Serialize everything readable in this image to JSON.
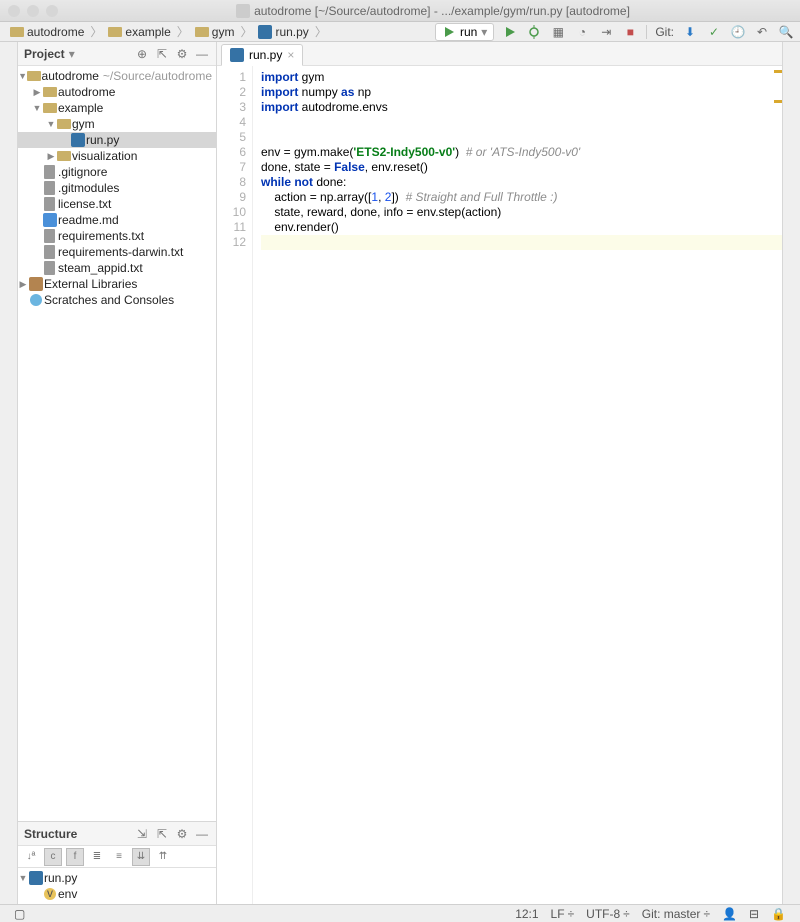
{
  "window_title": "autodrome [~/Source/autodrome] - .../example/gym/run.py [autodrome]",
  "breadcrumbs": [
    "autodrome",
    "example",
    "gym",
    "run.py"
  ],
  "run_config": "run",
  "git_label": "Git:",
  "project": {
    "title": "Project",
    "tree": [
      {
        "ind": 0,
        "arrow": "▼",
        "icon": "folder",
        "label": "autodrome",
        "muted": "~/Source/autodrome"
      },
      {
        "ind": 1,
        "arrow": "▶",
        "icon": "folder",
        "label": "autodrome"
      },
      {
        "ind": 1,
        "arrow": "▼",
        "icon": "folder",
        "label": "example"
      },
      {
        "ind": 2,
        "arrow": "▼",
        "icon": "folder",
        "label": "gym"
      },
      {
        "ind": 3,
        "arrow": "",
        "icon": "py",
        "label": "run.py",
        "selected": true
      },
      {
        "ind": 2,
        "arrow": "▶",
        "icon": "folder",
        "label": "visualization"
      },
      {
        "ind": 1,
        "arrow": "",
        "icon": "file",
        "label": ".gitignore"
      },
      {
        "ind": 1,
        "arrow": "",
        "icon": "file",
        "label": ".gitmodules"
      },
      {
        "ind": 1,
        "arrow": "",
        "icon": "file",
        "label": "license.txt"
      },
      {
        "ind": 1,
        "arrow": "",
        "icon": "md",
        "label": "readme.md"
      },
      {
        "ind": 1,
        "arrow": "",
        "icon": "file",
        "label": "requirements.txt"
      },
      {
        "ind": 1,
        "arrow": "",
        "icon": "file",
        "label": "requirements-darwin.txt"
      },
      {
        "ind": 1,
        "arrow": "",
        "icon": "file",
        "label": "steam_appid.txt"
      },
      {
        "ind": 0,
        "arrow": "▶",
        "icon": "lib",
        "label": "External Libraries"
      },
      {
        "ind": 0,
        "arrow": "",
        "icon": "scratch",
        "label": "Scratches and Consoles"
      }
    ]
  },
  "structure": {
    "title": "Structure",
    "tree": [
      {
        "ind": 0,
        "arrow": "▼",
        "icon": "py",
        "label": "run.py"
      },
      {
        "ind": 1,
        "arrow": "",
        "icon": "var",
        "label": "env"
      }
    ]
  },
  "tab": {
    "label": "run.py"
  },
  "code": {
    "lines": [
      {
        "n": 1,
        "segs": [
          {
            "t": "import ",
            "c": "kw"
          },
          {
            "t": "gym"
          }
        ]
      },
      {
        "n": 2,
        "segs": [
          {
            "t": "import ",
            "c": "kw"
          },
          {
            "t": "numpy "
          },
          {
            "t": "as ",
            "c": "kw"
          },
          {
            "t": "np"
          }
        ]
      },
      {
        "n": 3,
        "segs": [
          {
            "t": "import ",
            "c": "kw"
          },
          {
            "t": "autodrome.envs"
          }
        ]
      },
      {
        "n": 4,
        "segs": []
      },
      {
        "n": 5,
        "segs": []
      },
      {
        "n": 6,
        "segs": [
          {
            "t": "env = gym.make("
          },
          {
            "t": "'ETS2-Indy500-v0'",
            "c": "str"
          },
          {
            "t": ")  "
          },
          {
            "t": "# or 'ATS-Indy500-v0'",
            "c": "cmt"
          }
        ]
      },
      {
        "n": 7,
        "segs": [
          {
            "t": "done, state = "
          },
          {
            "t": "False",
            "c": "bool"
          },
          {
            "t": ", env.reset()"
          }
        ]
      },
      {
        "n": 8,
        "segs": [
          {
            "t": "while not ",
            "c": "kw"
          },
          {
            "t": "done:"
          }
        ]
      },
      {
        "n": 9,
        "segs": [
          {
            "t": "    action = np.array(["
          },
          {
            "t": "1",
            "c": "num"
          },
          {
            "t": ", "
          },
          {
            "t": "2",
            "c": "num"
          },
          {
            "t": "])  "
          },
          {
            "t": "# Straight and Full Throttle :)",
            "c": "cmt"
          }
        ]
      },
      {
        "n": 10,
        "segs": [
          {
            "t": "    state, reward, done, info = env.step(action)"
          }
        ]
      },
      {
        "n": 11,
        "segs": [
          {
            "t": "    env.render()"
          }
        ]
      },
      {
        "n": 12,
        "segs": [],
        "current": true
      }
    ]
  },
  "status": {
    "pos": "12:1",
    "lf": "LF",
    "enc": "UTF-8",
    "git": "Git: master"
  }
}
